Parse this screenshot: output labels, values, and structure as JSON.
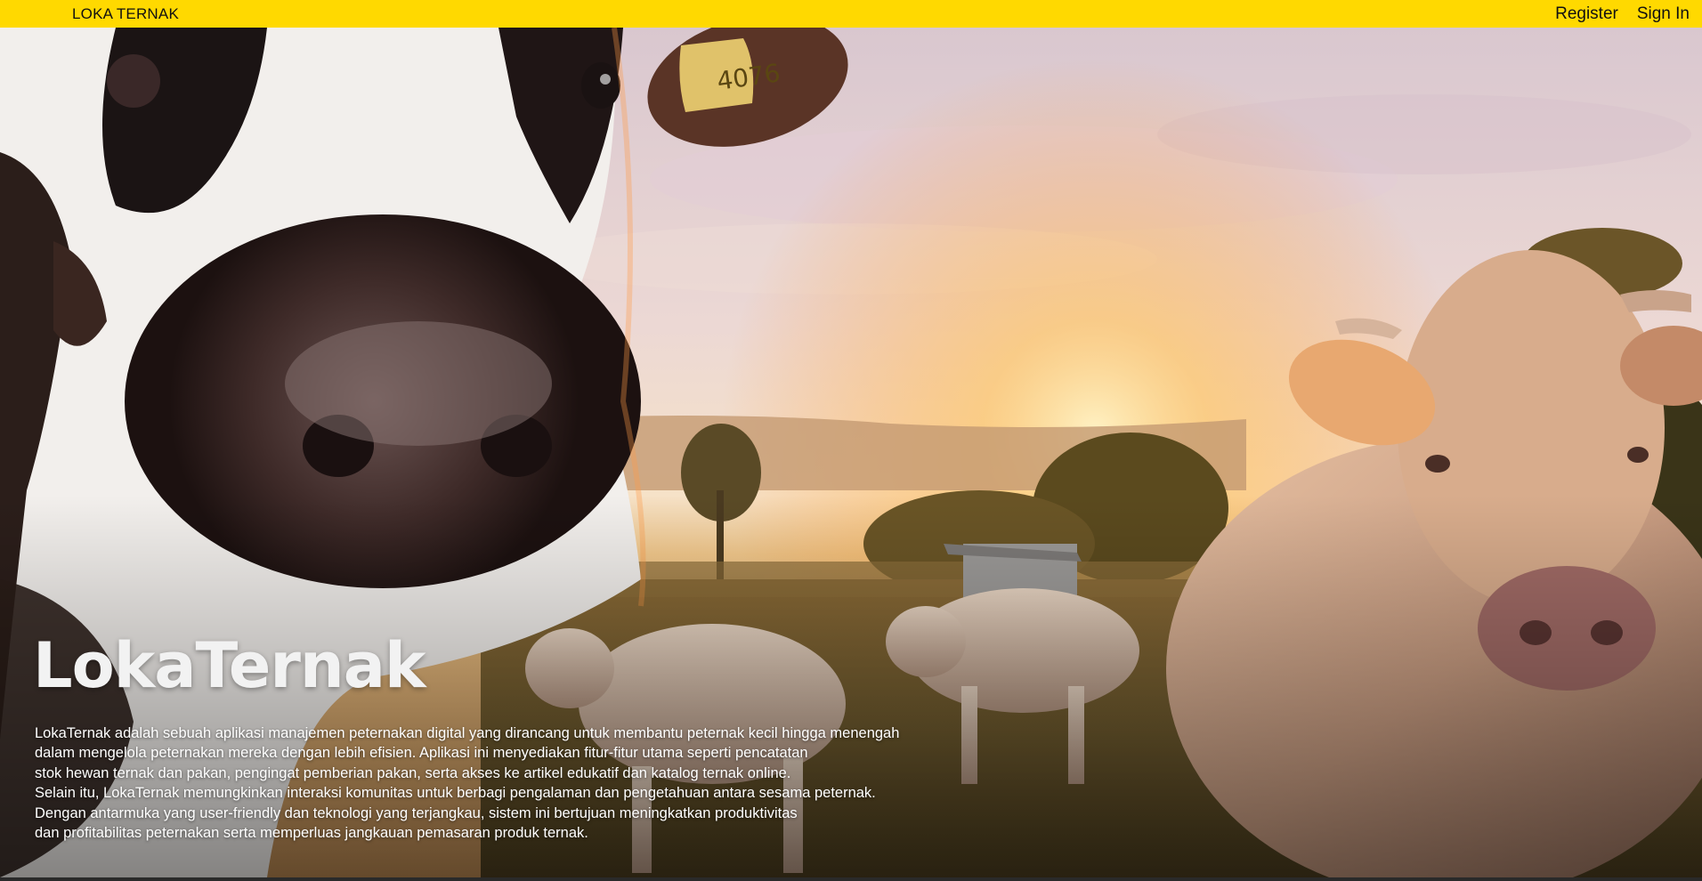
{
  "header": {
    "brand": "LOKA TERNAK",
    "register_label": "Register",
    "signin_label": "Sign In",
    "background_color": "#ffd900"
  },
  "hero": {
    "title": "LokaTernak",
    "description_lines": [
      "LokaTernak adalah sebuah aplikasi manajemen peternakan digital yang dirancang untuk membantu peternak kecil hingga menengah",
      "dalam mengelola peternakan mereka dengan lebih efisien. Aplikasi ini menyediakan fitur-fitur utama seperti pencatatan",
      "stok hewan ternak dan pakan, pengingat pemberian pakan, serta akses ke artikel edukatif dan katalog ternak online.",
      "Selain itu, LokaTernak memungkinkan interaksi komunitas untuk berbagi pengalaman dan pengetahuan antara sesama peternak.",
      "Dengan antarmuka yang user-friendly dan teknologi yang terjangkau, sistem ini bertujuan meningkatkan produktivitas",
      "dan profitabilitas peternakan serta memperluas jangkauan pemasaran produk ternak."
    ]
  },
  "ear_tag": {
    "number": "4076"
  }
}
